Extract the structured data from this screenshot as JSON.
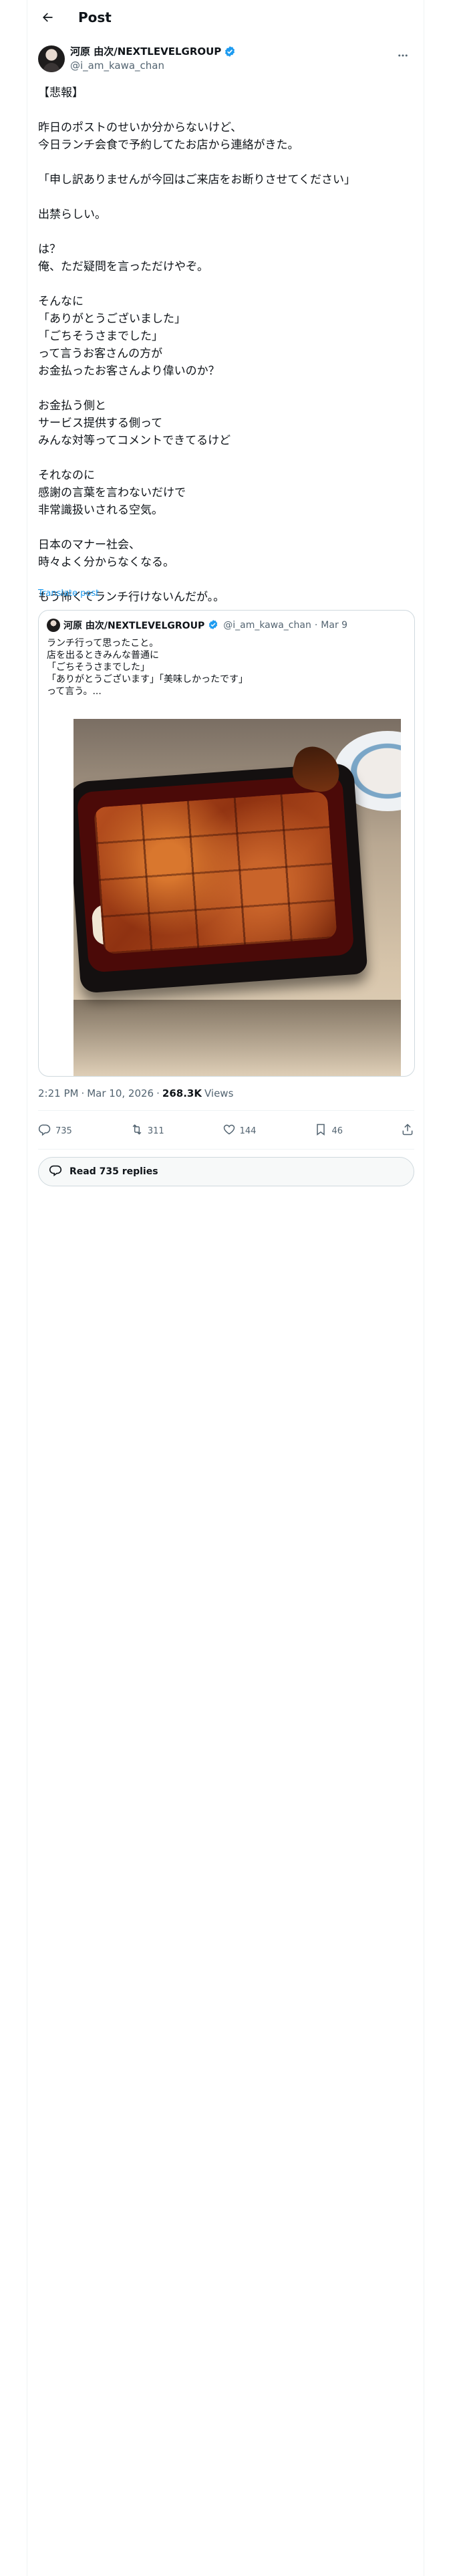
{
  "header": {
    "title": "Post"
  },
  "author": {
    "display_name": "河原 由次/NEXTLEVELGROUP",
    "handle": "@i_am_kawa_chan"
  },
  "tweet": {
    "text": "【悲報】\n\n昨日のポストのせいか分からないけど、\n今日ランチ会食で予約してたお店から連絡がきた。\n\n「申し訳ありませんが今回はご来店をお断りさせてください」\n\n出禁らしい。\n\nは？\n俺、ただ疑問を言っただけやぞ。\n\nそんなに\n「ありがとうございました」\n「ごちそうさまでした」\nって言うお客さんの方が\nお金払ったお客さんより偉いのか？\n\nお金払う側と\nサービス提供する側って\nみんな対等ってコメントできてるけど\n\nそれなのに\n感謝の言葉を言わないだけで\n非常識扱いされる空気。\n\n日本のマナー社会、\n時々よく分からなくなる。\n\nもう怖くてランチ行けないんだが。。",
    "translate_label": "Translate post"
  },
  "quote": {
    "display_name": "河原 由次/NEXTLEVELGROUP",
    "handle": "@i_am_kawa_chan",
    "separator": "·",
    "date": "Mar 9",
    "text": "ランチ行って思ったこと。\n店を出るときみんな普通に\n「ごちそうさまでした」\n「ありがとうございます」「美味しかったです」\nって言う。..."
  },
  "meta": {
    "time": "2:21 PM",
    "separator1": "·",
    "date": "Mar 10, 2026",
    "separator2": "·",
    "views": "268.3K",
    "views_label": "Views"
  },
  "actions": {
    "replies": "735",
    "reposts": "311",
    "likes": "144",
    "bookmarks": "46"
  },
  "read_replies": {
    "label": "Read 735 replies"
  },
  "colors": {
    "accent": "#1d9bf0",
    "text_primary": "#0f1419",
    "text_secondary": "#536471",
    "border": "#cfd9de"
  },
  "icons": [
    "back-arrow-icon",
    "verified-badge-icon",
    "more-icon",
    "reply-icon",
    "repost-icon",
    "like-icon",
    "bookmark-icon",
    "share-icon",
    "replies-bubble-icon"
  ]
}
